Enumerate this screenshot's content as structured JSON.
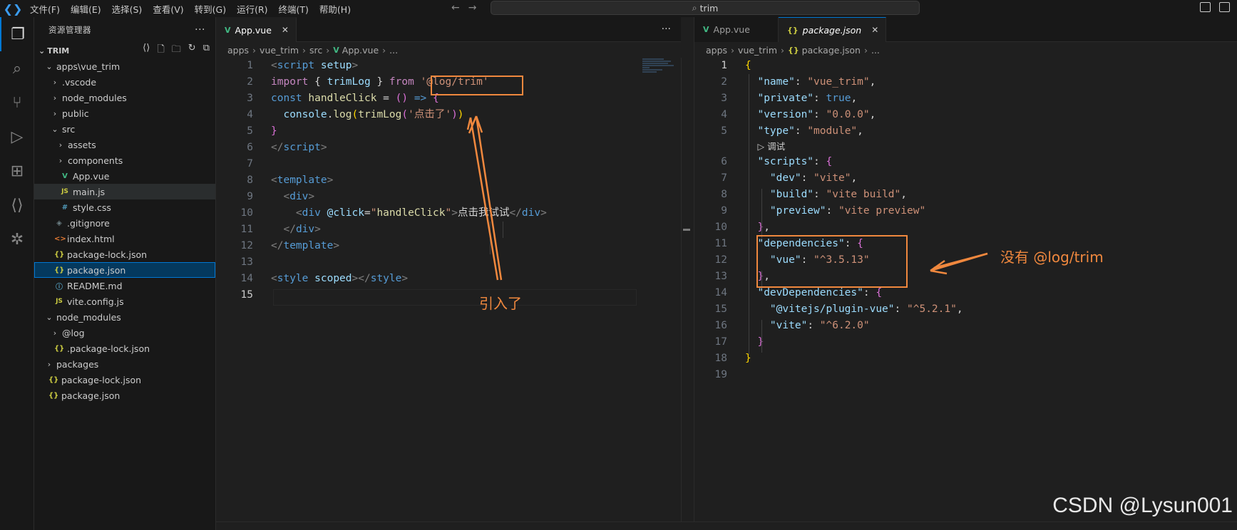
{
  "menu": [
    "文件(F)",
    "编辑(E)",
    "选择(S)",
    "查看(V)",
    "转到(G)",
    "运行(R)",
    "终端(T)",
    "帮助(H)"
  ],
  "command_center": "trim",
  "sidebar": {
    "title": "资源管理器",
    "root": "TRIM",
    "tree": [
      {
        "label": "apps\\vue_trim",
        "chev": "⌄",
        "icon": ""
      },
      {
        "label": ".vscode",
        "chev": "›",
        "icon": ""
      },
      {
        "label": "node_modules",
        "chev": "›",
        "icon": ""
      },
      {
        "label": "public",
        "chev": "›",
        "icon": ""
      },
      {
        "label": "src",
        "chev": "⌄",
        "icon": ""
      },
      {
        "label": "assets",
        "chev": "›",
        "icon": ""
      },
      {
        "label": "components",
        "chev": "›",
        "icon": ""
      },
      {
        "label": "App.vue",
        "chev": "",
        "icon": "V"
      },
      {
        "label": "main.js",
        "chev": "",
        "icon": "JS"
      },
      {
        "label": "style.css",
        "chev": "",
        "icon": "#"
      },
      {
        "label": ".gitignore",
        "chev": "",
        "icon": "◈"
      },
      {
        "label": "index.html",
        "chev": "",
        "icon": "<>"
      },
      {
        "label": "package-lock.json",
        "chev": "",
        "icon": "{}"
      },
      {
        "label": "package.json",
        "chev": "",
        "icon": "{}"
      },
      {
        "label": "README.md",
        "chev": "",
        "icon": "ⓘ"
      },
      {
        "label": "vite.config.js",
        "chev": "",
        "icon": "JS"
      },
      {
        "label": "node_modules",
        "chev": "⌄",
        "icon": ""
      },
      {
        "label": "@log",
        "chev": "›",
        "icon": ""
      },
      {
        "label": ".package-lock.json",
        "chev": "",
        "icon": "{}"
      },
      {
        "label": "packages",
        "chev": "›",
        "icon": ""
      },
      {
        "label": "package-lock.json",
        "chev": "",
        "icon": "{}"
      },
      {
        "label": "package.json",
        "chev": "",
        "icon": "{}"
      }
    ]
  },
  "left_editor": {
    "tab": "App.vue",
    "breadcrumb": [
      "apps",
      "vue_trim",
      "src",
      "App.vue",
      "..."
    ],
    "line_numbers": [
      "1",
      "2",
      "3",
      "4",
      "5",
      "6",
      "7",
      "8",
      "9",
      "10",
      "11",
      "12",
      "13",
      "14",
      "15"
    ]
  },
  "right_editor": {
    "tabs": [
      "App.vue",
      "package.json"
    ],
    "breadcrumb": [
      "apps",
      "vue_trim",
      "package.json",
      "..."
    ],
    "line_numbers": [
      "1",
      "2",
      "3",
      "4",
      "5",
      "",
      "6",
      "7",
      "8",
      "9",
      "10",
      "11",
      "12",
      "13",
      "14",
      "15",
      "16",
      "17",
      "18",
      "19"
    ],
    "debug_lens": "调试"
  },
  "annotations": {
    "imported": "引入了",
    "missing": "没有 @log/trim"
  },
  "watermark": "CSDN @Lysun001",
  "colors": {
    "accent": "#0078d4",
    "annotation": "#f0883e"
  }
}
